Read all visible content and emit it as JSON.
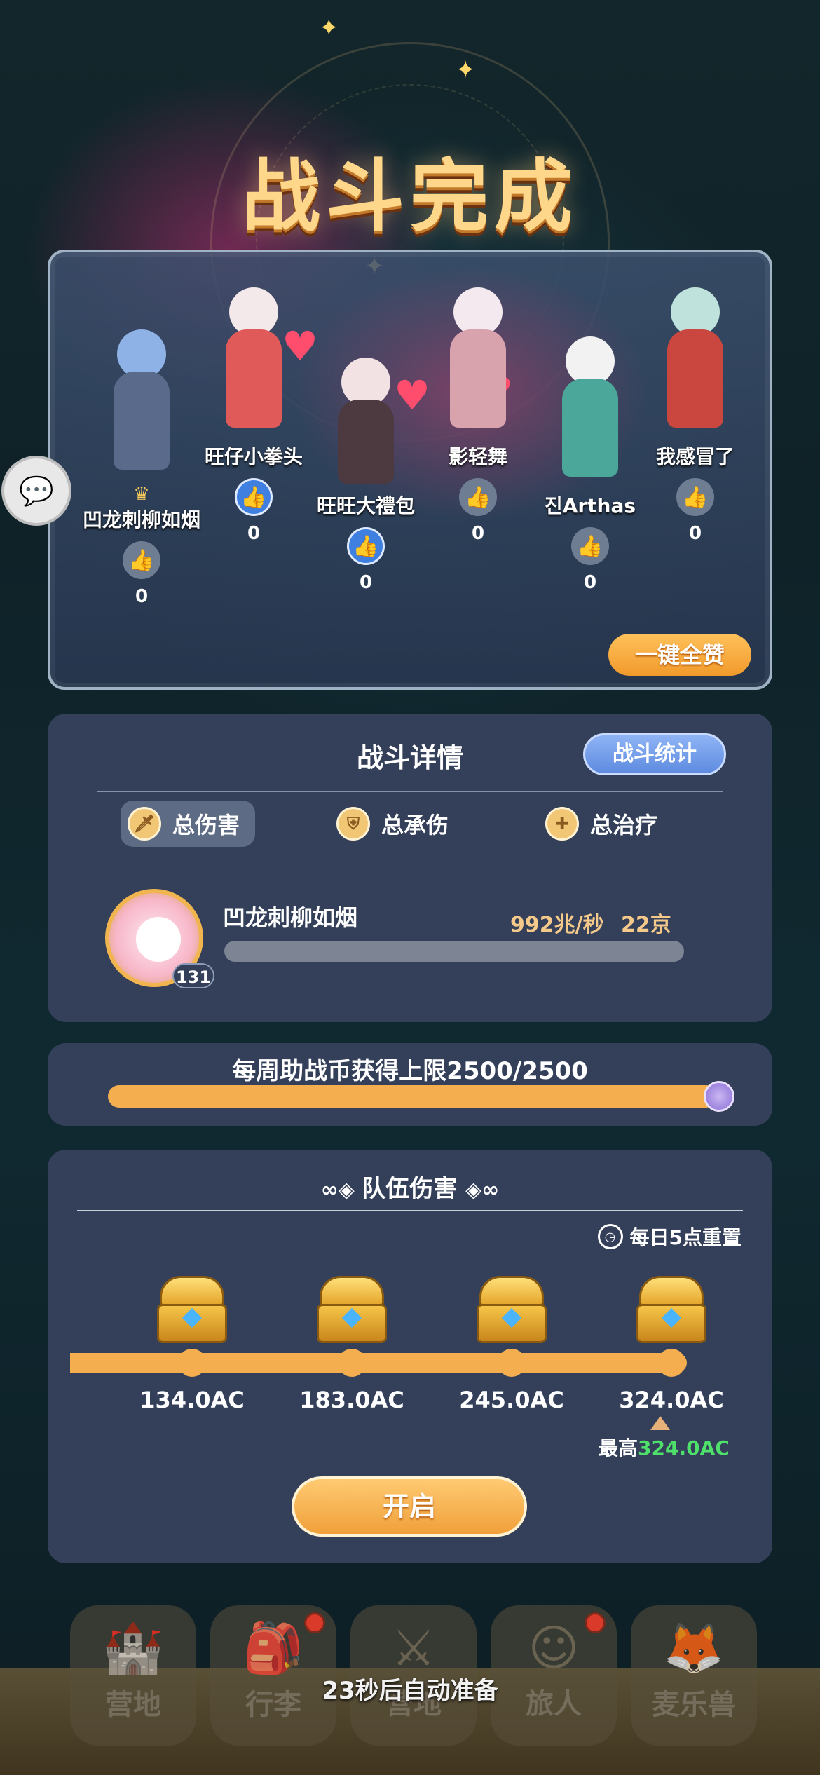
{
  "title": "战斗完成",
  "heroes": [
    {
      "name": "凹龙刺柳如烟",
      "likes": "0",
      "liked": false,
      "crown": true
    },
    {
      "name": "旺仔小拳头",
      "likes": "0",
      "liked": true,
      "crown": false
    },
    {
      "name": "旺旺大禮包",
      "likes": "0",
      "liked": true,
      "crown": false
    },
    {
      "name": "影轻舞",
      "likes": "0",
      "liked": false,
      "crown": false
    },
    {
      "name": "진Arthas",
      "likes": "0",
      "liked": false,
      "crown": false
    },
    {
      "name": "我感冒了",
      "likes": "0",
      "liked": false,
      "crown": false
    }
  ],
  "like_all_label": "一键全赞",
  "detail": {
    "title": "战斗详情",
    "stats_button": "战斗统计",
    "tabs": [
      {
        "label": "总伤害",
        "icon": "sword-icon",
        "active": true
      },
      {
        "label": "总承伤",
        "icon": "shield-icon",
        "active": false
      },
      {
        "label": "总治疗",
        "icon": "heal-icon",
        "active": false
      }
    ],
    "player": {
      "name": "凹龙刺柳如烟",
      "level": "131",
      "dps": "992兆/秒",
      "total": "22京"
    }
  },
  "weekly": {
    "text": "每周助战币获得上限2500/2500",
    "progress": 1.0
  },
  "team_damage": {
    "title": "队伍伤害",
    "reset_text": "每日5点重置",
    "milestones": [
      "134.0AC",
      "183.0AC",
      "245.0AC",
      "324.0AC"
    ],
    "best_label": "最高",
    "best_value": "324.0AC",
    "open_label": "开启"
  },
  "nav": [
    {
      "label": "营地",
      "icon": "castle-icon",
      "dot": false
    },
    {
      "label": "行李",
      "icon": "backpack-icon",
      "dot": true
    },
    {
      "label": "营地",
      "icon": "swords-icon",
      "dot": false
    },
    {
      "label": "旅人",
      "icon": "traveler-icon",
      "dot": true
    },
    {
      "label": "麦乐兽",
      "icon": "beast-icon",
      "dot": false
    }
  ],
  "auto_ready_text": "23秒后自动准备",
  "colors": {
    "accent_orange": "#f4ae4f",
    "panel": "#34405a",
    "stat_blue": "#5e8be0",
    "best_green": "#4ee06a"
  }
}
